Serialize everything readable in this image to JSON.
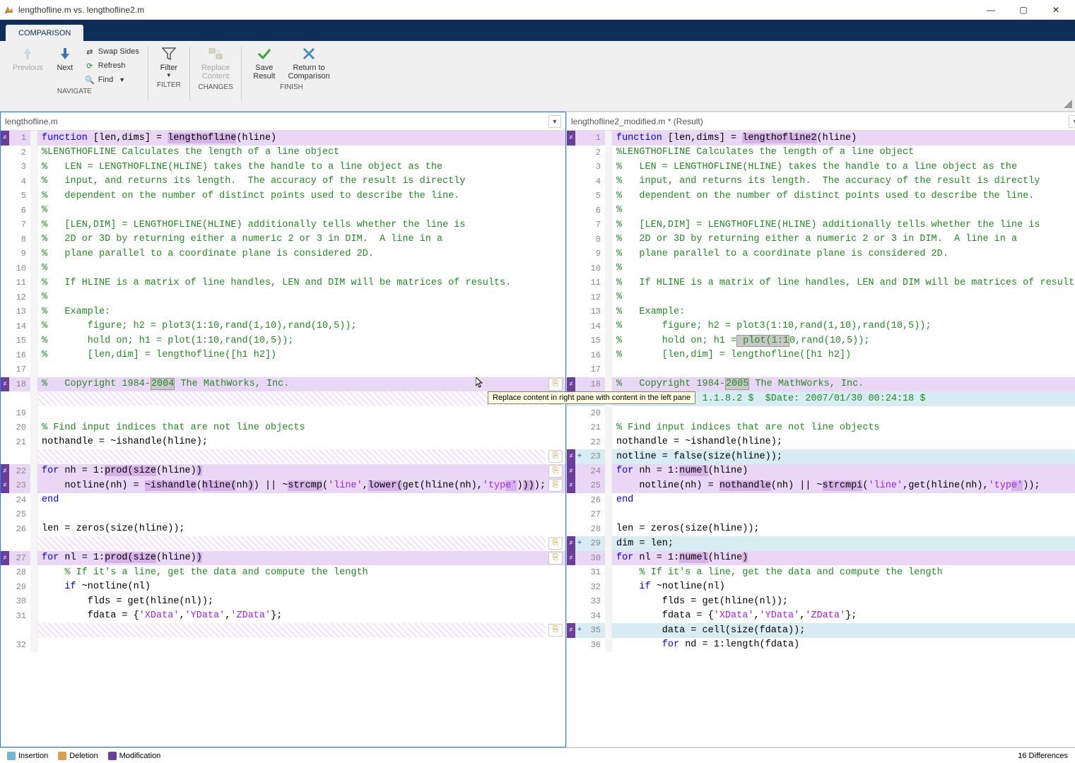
{
  "window": {
    "title": "lengthofline.m vs. lengthofline2.m"
  },
  "tab": "COMPARISON",
  "ribbon": {
    "navigate": {
      "label": "NAVIGATE",
      "previous": "Previous",
      "next": "Next",
      "swap": "Swap Sides",
      "refresh": "Refresh",
      "find": "Find"
    },
    "filter": {
      "label": "FILTER",
      "filter": "Filter"
    },
    "changes": {
      "label": "CHANGES",
      "replace1": "Replace",
      "replace2": "Content"
    },
    "finish": {
      "label": "FINISH",
      "save1": "Save",
      "save2": "Result",
      "return1": "Return to",
      "return2": "Comparison"
    }
  },
  "left_file": {
    "name": "lengthofline.m"
  },
  "right_file": {
    "name": "lengthofline2_modified.m * (Result)"
  },
  "tooltip_text": "Replace content in right pane with content in the left pane",
  "statusbar": {
    "insertion": "Insertion",
    "deletion": "Deletion",
    "modification": "Modification",
    "diff_count": "16 Differences"
  },
  "colors": {
    "insertion": "#6fb9d6",
    "deletion": "#d6a24d",
    "modification": "#6b3f98"
  },
  "chart_data": null,
  "code_left": [
    {
      "n": 1,
      "cls": "line-mod",
      "diff": true,
      "html": "<span class='kw'>function</span> [len,dims] = <span class='hl-mod'>lengthofline</span>(hline)"
    },
    {
      "n": 2,
      "html": "<span class='cm'>%LENGTHOFLINE Calculates the length of a line object</span>"
    },
    {
      "n": 3,
      "html": "<span class='cm'>%   LEN = LENGTHOFLINE(HLINE) takes the handle to a line object as the</span>"
    },
    {
      "n": 4,
      "html": "<span class='cm'>%   input, and returns its length.  The accuracy of the result is directly</span>"
    },
    {
      "n": 5,
      "html": "<span class='cm'>%   dependent on the number of distinct points used to describe the line.</span>"
    },
    {
      "n": 6,
      "html": "<span class='cm'>%</span>"
    },
    {
      "n": 7,
      "html": "<span class='cm'>%   [LEN,DIM] = LENGTHOFLINE(HLINE) additionally tells whether the line is</span>"
    },
    {
      "n": 8,
      "html": "<span class='cm'>%   2D or 3D by returning either a numeric 2 or 3 in DIM.  A line in a</span>"
    },
    {
      "n": 9,
      "html": "<span class='cm'>%   plane parallel to a coordinate plane is considered 2D.</span>"
    },
    {
      "n": 10,
      "html": "<span class='cm'>%</span>"
    },
    {
      "n": 11,
      "html": "<span class='cm'>%   If HLINE is a matrix of line handles, LEN and DIM will be matrices of results.</span>"
    },
    {
      "n": 12,
      "html": "<span class='cm'>%</span>"
    },
    {
      "n": 13,
      "html": "<span class='cm'>%   Example:</span>"
    },
    {
      "n": 14,
      "html": "<span class='cm'>%       figure; h2 = plot3(1:10,rand(1,10),rand(10,5));</span>"
    },
    {
      "n": 15,
      "html": "<span class='cm'>%       hold on; h1 = plot(1:10,rand(10,5));</span>"
    },
    {
      "n": 16,
      "html": "<span class='cm'>%       [len,dim] = lengthofline([h1 h2])</span>"
    },
    {
      "n": 17,
      "html": ""
    },
    {
      "n": 18,
      "cls": "line-mod",
      "diff": true,
      "merge": true,
      "html": "<span class='cm'>%   Copyright 1984-<span class='hl-box'>2004</span> The MathWorks, Inc.</span>"
    },
    {
      "n": 0,
      "hatched": true,
      "merge": true
    },
    {
      "n": 19,
      "html": ""
    },
    {
      "n": 20,
      "html": "<span class='cm'>% Find input indices that are not line objects</span>"
    },
    {
      "n": 21,
      "html": "nothandle = ~ishandle(hline);"
    },
    {
      "n": 0,
      "cls": "hatched",
      "hatched": true,
      "merge": true
    },
    {
      "n": 22,
      "cls": "line-mod",
      "diff": true,
      "merge": true,
      "html": "<span class='kw'>for</span> nh = 1:<span class='hl-mod'>prod(size</span>(hline)<span class='hl-mod'>)</span>"
    },
    {
      "n": 23,
      "cls": "line-mod",
      "diff": true,
      "merge": true,
      "html": "    notline(nh) = <span class='hl-mod'>~ishandle</span>(<span class='hl-mod'>hline(</span>nh<span class='hl-mod'>)</span>) || ~<span class='hl-mod'>strcmp</span>(<span class='str'>'line'</span>,<span class='hl-mod'>lower(</span>get(hline(nh),<span class='str'>'typ<span class='hl-mod'>e'</span></span>)<span class='hl-mod'>))</span>);"
    },
    {
      "n": 24,
      "html": "<span class='kw'>end</span>"
    },
    {
      "n": 25,
      "html": ""
    },
    {
      "n": 26,
      "html": "len = zeros(size(hline));"
    },
    {
      "n": 0,
      "hatched": true,
      "merge": true
    },
    {
      "n": 27,
      "cls": "line-mod",
      "diff": true,
      "merge": true,
      "html": "<span class='kw'>for</span> nl = 1:<span class='hl-mod'>prod(size</span>(hline)<span class='hl-mod'>)</span>"
    },
    {
      "n": 28,
      "html": "    <span class='cm'>% If it's a line, get the data and compute the length</span>"
    },
    {
      "n": 29,
      "html": "    <span class='kw'>if</span> ~notline(nl)"
    },
    {
      "n": 30,
      "html": "        flds = get(hline(nl));"
    },
    {
      "n": 31,
      "html": "        fdata = {<span class='str'>'XData'</span>,<span class='str'>'YData'</span>,<span class='str'>'ZData'</span>};"
    },
    {
      "n": 0,
      "hatched": true,
      "merge": true
    },
    {
      "n": 32,
      "html": ""
    }
  ],
  "code_right": [
    {
      "n": 1,
      "cls": "line-mod",
      "diff": true,
      "html": "<span class='kw'>function</span> [len,dims] = <span class='hl-mod'>lengthofline2</span>(hline)"
    },
    {
      "n": 2,
      "html": "<span class='cm'>%LENGTHOFLINE Calculates the length of a line object</span>"
    },
    {
      "n": 3,
      "html": "<span class='cm'>%   LEN = LENGTHOFLINE(HLINE) takes the handle to a line object as the</span>"
    },
    {
      "n": 4,
      "html": "<span class='cm'>%   input, and returns its length.  The accuracy of the result is directly</span>"
    },
    {
      "n": 5,
      "html": "<span class='cm'>%   dependent on the number of distinct points used to describe the line.</span>"
    },
    {
      "n": 6,
      "html": "<span class='cm'>%</span>"
    },
    {
      "n": 7,
      "html": "<span class='cm'>%   [LEN,DIM] = LENGTHOFLINE(HLINE) additionally tells whether the line is</span>"
    },
    {
      "n": 8,
      "html": "<span class='cm'>%   2D or 3D by returning either a numeric 2 or 3 in DIM.  A line in a</span>"
    },
    {
      "n": 9,
      "html": "<span class='cm'>%   plane parallel to a coordinate plane is considered 2D.</span>"
    },
    {
      "n": 10,
      "html": "<span class='cm'>%</span>"
    },
    {
      "n": 11,
      "html": "<span class='cm'>%   If HLINE is a matrix of line handles, LEN and DIM will be matrices of results.</span>"
    },
    {
      "n": 12,
      "html": "<span class='cm'>%</span>"
    },
    {
      "n": 13,
      "html": "<span class='cm'>%   Example:</span>"
    },
    {
      "n": 14,
      "html": "<span class='cm'>%       figure; h2 = plot3(1:10,rand(1,10),rand(10,5));</span>"
    },
    {
      "n": 15,
      "html": "<span class='cm'>%       hold on; h1 =<span class='hl-box'> plot(1:1</span>0,rand(10,5));</span>"
    },
    {
      "n": 16,
      "html": "<span class='cm'>%       [len,dim] = lengthofline([h1 h2])</span>"
    },
    {
      "n": 17,
      "html": ""
    },
    {
      "n": 18,
      "cls": "line-mod",
      "diff": true,
      "html": "<span class='cm'>%   Copyright 1984-<span class='hl-box'>2005</span> The MathWorks, Inc.</span>"
    },
    {
      "n": 19,
      "cls": "line-ins",
      "plus": "+",
      "html": "<span class='cm'>%   $Revision: 1.1.8.2 $  $Date: 2007/01/30 00:24:18 $</span>"
    },
    {
      "n": 20,
      "html": ""
    },
    {
      "n": 21,
      "html": "<span class='cm'>% Find input indices that are not line objects</span>"
    },
    {
      "n": 22,
      "html": "nothandle = ~ishandle(hline);"
    },
    {
      "n": 23,
      "cls": "line-ins",
      "diff": true,
      "plus": "+",
      "html": "notline = false(size(hline));"
    },
    {
      "n": 24,
      "cls": "line-mod",
      "diff": true,
      "html": "<span class='kw'>for</span> nh = 1:<span class='hl-mod'>numel</span>(hline)"
    },
    {
      "n": 25,
      "cls": "line-mod",
      "diff": true,
      "html": "    notline(nh) = <span class='hl-mod'>nothandle</span>(nh) || ~<span class='hl-mod'>strcmpi</span>(<span class='str'>'line'</span>,get(hline(nh),<span class='str'>'typ<span class='hl-mod'>e'</span></span>));"
    },
    {
      "n": 26,
      "html": "<span class='kw'>end</span>"
    },
    {
      "n": 27,
      "html": ""
    },
    {
      "n": 28,
      "html": "len = zeros(size(hline));"
    },
    {
      "n": 29,
      "cls": "line-ins",
      "diff": true,
      "plus": "+",
      "html": "dim = len;"
    },
    {
      "n": 30,
      "cls": "line-mod",
      "diff": true,
      "html": "<span class='kw'>for</span> nl = 1:<span class='hl-mod'>numel</span>(hline<span class='hl-mod'>)</span>"
    },
    {
      "n": 31,
      "html": "    <span class='cm'>% If it's a line, get the data and compute the length</span>"
    },
    {
      "n": 32,
      "html": "    <span class='kw'>if</span> ~notline(nl)"
    },
    {
      "n": 33,
      "html": "        flds = get(hline(nl));"
    },
    {
      "n": 34,
      "html": "        fdata = {<span class='str'>'XData'</span>,<span class='str'>'YData'</span>,<span class='str'>'ZData'</span>};"
    },
    {
      "n": 35,
      "cls": "line-ins",
      "diff": true,
      "plus": "+",
      "html": "        data = cell(size(fdata));"
    },
    {
      "n": 36,
      "html": "        <span class='kw'>for</span> nd = 1:length(fdata)"
    }
  ]
}
